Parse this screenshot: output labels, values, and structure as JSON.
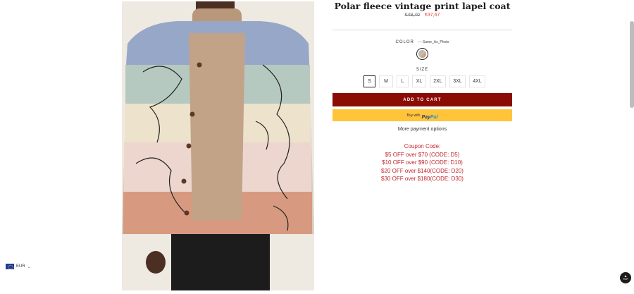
{
  "product": {
    "title": "Polar fleece vintage print lapel coat",
    "old_price": "€49,40",
    "new_price": "€37,67"
  },
  "options": {
    "color_label": "COLOR",
    "color_value": "— Same_As_Photo",
    "size_label": "SIZE",
    "sizes": [
      "S",
      "M",
      "L",
      "XL",
      "2XL",
      "3XL",
      "4XL"
    ],
    "selected_size": "S"
  },
  "buttons": {
    "add_to_cart": "ADD TO CART",
    "paypal_prefix": "Buy with",
    "paypal_brand_a": "Pay",
    "paypal_brand_b": "Pal",
    "more_payment": "More payment options"
  },
  "coupons": {
    "heading": "Coupon Code:",
    "lines": [
      "$5 OFF over $70 (CODE: D5)",
      "$10 OFF over $90 (CODE: D10)",
      "$20 OFF over $140(CODE: D20)",
      "$30 OFF over $180(CODE: D30)"
    ]
  },
  "currency": {
    "code": "EUR"
  },
  "scroll_top": {
    "label": "TOP"
  },
  "colors": {
    "cart_button": "#8b0c05",
    "paypal_button": "#ffc439",
    "sale_price": "#e0463a",
    "coupon_text": "#c1272d"
  },
  "icons": [
    "eu-flag-icon",
    "chevron-down-icon",
    "arrow-up-icon"
  ]
}
